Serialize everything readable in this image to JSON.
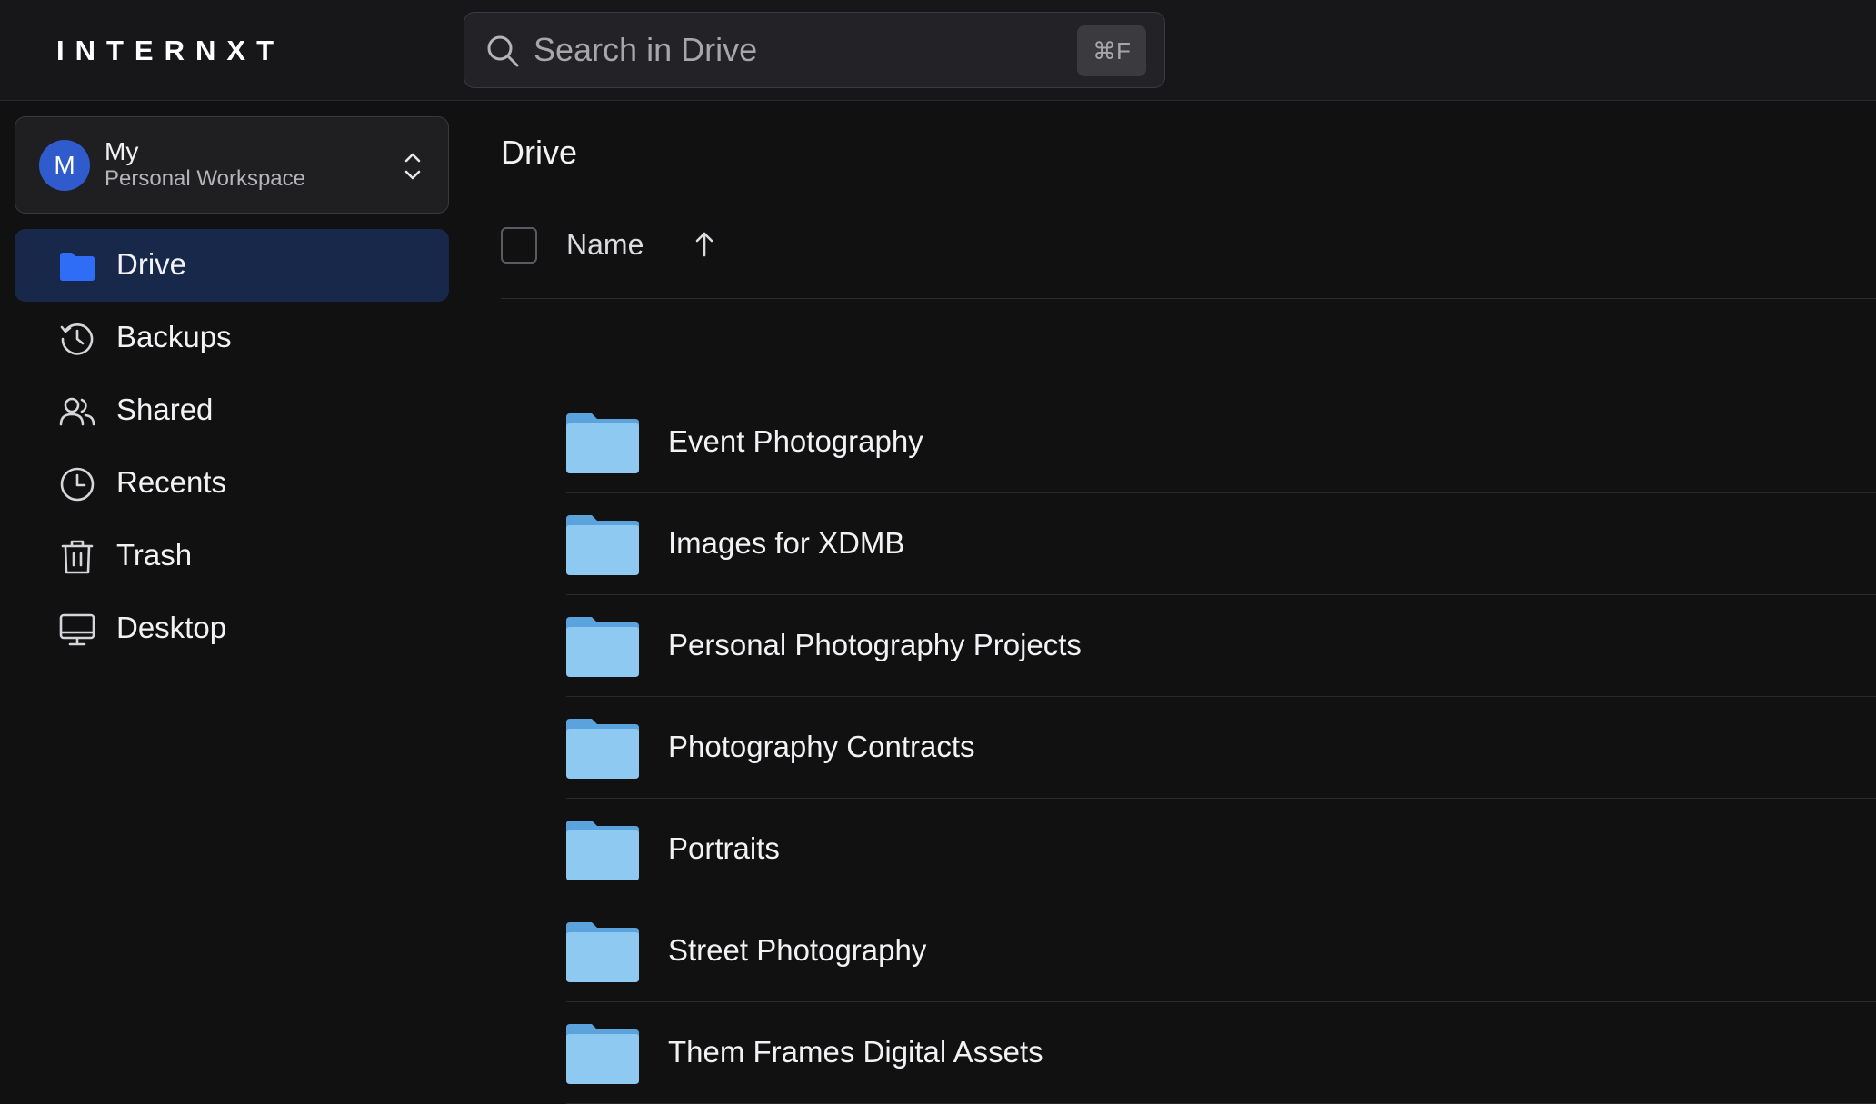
{
  "app": {
    "logo": "INTERNXT"
  },
  "search": {
    "placeholder": "Search in Drive",
    "shortcut": "⌘F"
  },
  "workspace": {
    "avatar_initial": "M",
    "name": "My",
    "subtitle": "Personal Workspace"
  },
  "sidebar": {
    "items": [
      {
        "label": "Drive",
        "icon": "folder-icon",
        "active": true
      },
      {
        "label": "Backups",
        "icon": "history-icon",
        "active": false
      },
      {
        "label": "Shared",
        "icon": "users-icon",
        "active": false
      },
      {
        "label": "Recents",
        "icon": "clock-icon",
        "active": false
      },
      {
        "label": "Trash",
        "icon": "trash-icon",
        "active": false
      },
      {
        "label": "Desktop",
        "icon": "monitor-icon",
        "active": false
      }
    ]
  },
  "main": {
    "title": "Drive",
    "columns": {
      "name": "Name",
      "sort": "ascending"
    },
    "items": [
      {
        "name": "Event Photography",
        "type": "folder"
      },
      {
        "name": "Images for XDMB",
        "type": "folder"
      },
      {
        "name": "Personal Photography Projects",
        "type": "folder"
      },
      {
        "name": "Photography Contracts",
        "type": "folder"
      },
      {
        "name": "Portraits",
        "type": "folder"
      },
      {
        "name": "Street Photography",
        "type": "folder"
      },
      {
        "name": "Them Frames Digital Assets",
        "type": "folder"
      }
    ]
  },
  "colors": {
    "accent": "#2f6df6",
    "active_nav_bg": "#17284a",
    "folder": "#8ec9f2"
  }
}
